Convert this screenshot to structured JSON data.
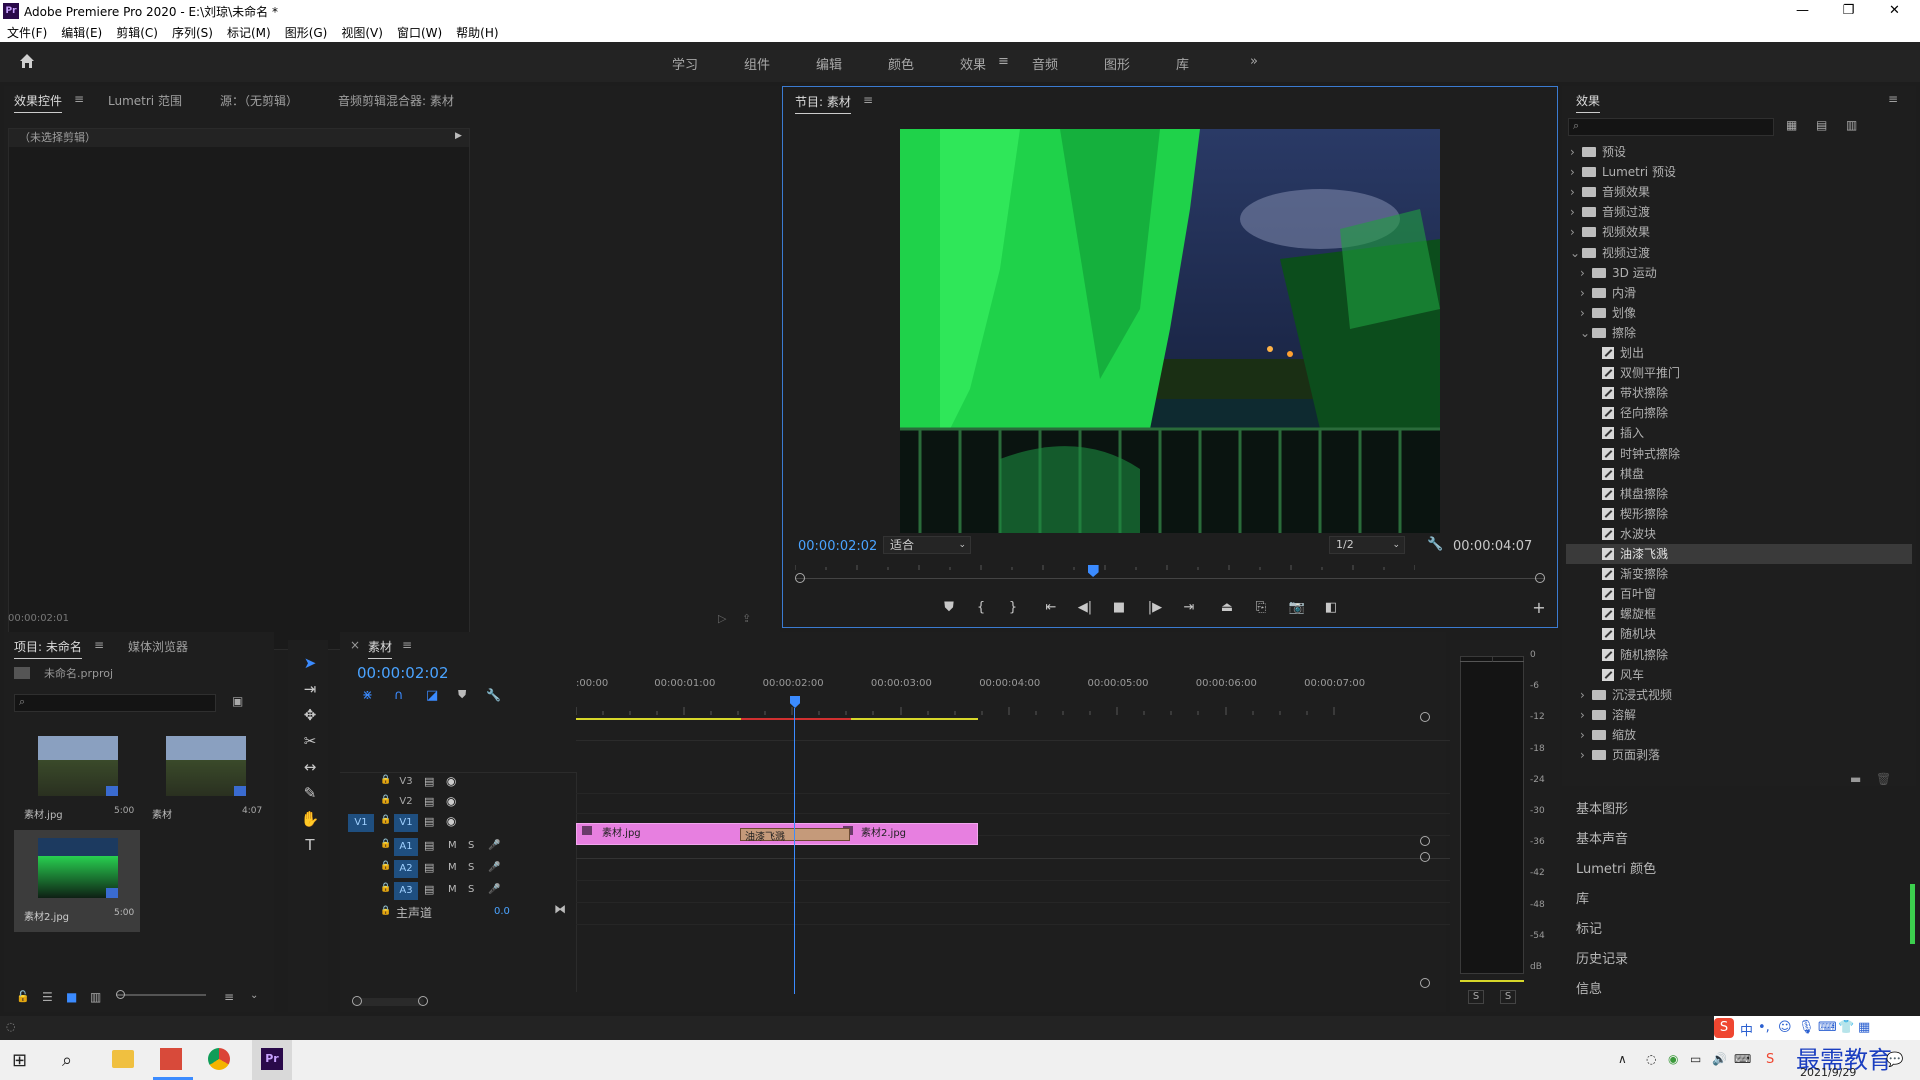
{
  "window": {
    "title": "Adobe Premiere Pro 2020 - E:\\刘琼\\未命名 *",
    "logo": "Pr",
    "minimize": "—",
    "maximize": "❐",
    "close": "✕"
  },
  "menu": [
    "文件(F)",
    "编辑(E)",
    "剪辑(C)",
    "序列(S)",
    "标记(M)",
    "图形(G)",
    "视图(V)",
    "窗口(W)",
    "帮助(H)"
  ],
  "workspaces": [
    "学习",
    "组件",
    "编辑",
    "颜色",
    "效果",
    "音频",
    "图形",
    "库"
  ],
  "workspace_active": "效果",
  "workspace_more": "»",
  "source_panel": {
    "tabs": [
      "效果控件",
      "Lumetri 范围",
      "源：（无剪辑）",
      "音频剪辑混合器: 素材"
    ],
    "no_clip": "（未选择剪辑）",
    "timecode": "00:00:02:01"
  },
  "program_monitor": {
    "tab": "节目: 素材",
    "timecode": "00:00:02:02",
    "fit": "适合",
    "quality": "1/2",
    "duration": "00:00:04:07",
    "playhead_fraction": 0.48
  },
  "effects_panel": {
    "title": "效果",
    "search_placeholder": "",
    "tree": [
      {
        "label": "预设",
        "type": "folder",
        "level": 0,
        "expanded": false
      },
      {
        "label": "Lumetri 预设",
        "type": "folder",
        "level": 0,
        "expanded": false
      },
      {
        "label": "音频效果",
        "type": "folder",
        "level": 0,
        "expanded": false
      },
      {
        "label": "音频过渡",
        "type": "folder",
        "level": 0,
        "expanded": false
      },
      {
        "label": "视频效果",
        "type": "folder",
        "level": 0,
        "expanded": false
      },
      {
        "label": "视频过渡",
        "type": "folder",
        "level": 0,
        "expanded": true
      },
      {
        "label": "3D 运动",
        "type": "folder",
        "level": 1,
        "expanded": false
      },
      {
        "label": "内滑",
        "type": "folder",
        "level": 1,
        "expanded": false
      },
      {
        "label": "划像",
        "type": "folder",
        "level": 1,
        "expanded": false
      },
      {
        "label": "擦除",
        "type": "folder",
        "level": 1,
        "expanded": true
      },
      {
        "label": "划出",
        "type": "fx",
        "level": 2
      },
      {
        "label": "双侧平推门",
        "type": "fx",
        "level": 2
      },
      {
        "label": "带状擦除",
        "type": "fx",
        "level": 2
      },
      {
        "label": "径向擦除",
        "type": "fx",
        "level": 2
      },
      {
        "label": "插入",
        "type": "fx",
        "level": 2
      },
      {
        "label": "时钟式擦除",
        "type": "fx",
        "level": 2
      },
      {
        "label": "棋盘",
        "type": "fx",
        "level": 2
      },
      {
        "label": "棋盘擦除",
        "type": "fx",
        "level": 2
      },
      {
        "label": "楔形擦除",
        "type": "fx",
        "level": 2
      },
      {
        "label": "水波块",
        "type": "fx",
        "level": 2
      },
      {
        "label": "油漆飞溅",
        "type": "fx",
        "level": 2,
        "selected": true
      },
      {
        "label": "渐变擦除",
        "type": "fx",
        "level": 2
      },
      {
        "label": "百叶窗",
        "type": "fx",
        "level": 2
      },
      {
        "label": "螺旋框",
        "type": "fx",
        "level": 2
      },
      {
        "label": "随机块",
        "type": "fx",
        "level": 2
      },
      {
        "label": "随机擦除",
        "type": "fx",
        "level": 2
      },
      {
        "label": "风车",
        "type": "fx",
        "level": 2
      },
      {
        "label": "沉浸式视频",
        "type": "folder",
        "level": 1,
        "expanded": false
      },
      {
        "label": "溶解",
        "type": "folder",
        "level": 1,
        "expanded": false
      },
      {
        "label": "缩放",
        "type": "folder",
        "level": 1,
        "expanded": false
      },
      {
        "label": "页面剥落",
        "type": "folder",
        "level": 1,
        "expanded": false
      }
    ]
  },
  "right_panels": [
    "基本图形",
    "基本声音",
    "Lumetri 颜色",
    "库",
    "标记",
    "历史记录",
    "信息"
  ],
  "project_panel": {
    "tabs": [
      "项目: 未命名",
      "媒体浏览器"
    ],
    "file": "未命名.prproj",
    "items": [
      {
        "name": "素材.jpg",
        "duration": "5:00"
      },
      {
        "name": "素材",
        "duration": "4:07"
      },
      {
        "name": "素材2.jpg",
        "duration": "5:00"
      }
    ]
  },
  "timeline": {
    "tab": "素材",
    "timecode": "00:00:02:02",
    "ruler": [
      ":00:00",
      "00:00:01:00",
      "00:00:02:00",
      "00:00:03:00",
      "00:00:04:00",
      "00:00:05:00",
      "00:00:06:00",
      "00:00:07:00"
    ],
    "video_tracks": [
      "V3",
      "V2",
      "V1"
    ],
    "audio_tracks": [
      "A1",
      "A2",
      "A3"
    ],
    "master": "主声道",
    "master_value": "0.0",
    "source_patch": "V1",
    "clips": [
      {
        "name": "素材.jpg"
      },
      {
        "name": "素材2.jpg"
      }
    ],
    "transition": "油漆飞溅",
    "mute": "M",
    "solo": "S"
  },
  "audio_meter": {
    "scale": [
      "0",
      "-6",
      "-12",
      "-18",
      "-24",
      "-30",
      "-36",
      "-42",
      "-48",
      "-54",
      "dB"
    ],
    "solo": [
      "S",
      "S"
    ]
  },
  "taskbar": {
    "date": "2021/9/29",
    "ime": "中",
    "watermark": "最需教育"
  },
  "colors": {
    "accent": "#4aa3ff",
    "clip": "#e77fe0",
    "transition": "#c59a7a"
  }
}
